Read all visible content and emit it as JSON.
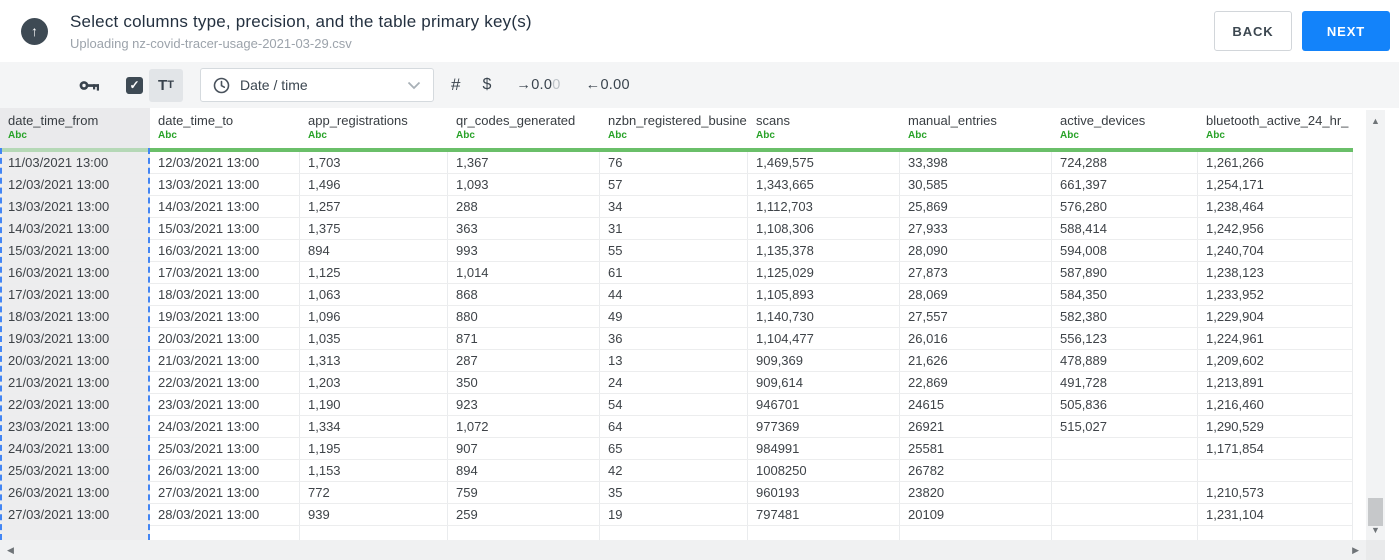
{
  "header": {
    "title": "Select columns type, precision, and the table primary key(s)",
    "subtitle": "Uploading nz-covid-tracer-usage-2021-03-29.csv",
    "back_label": "BACK",
    "next_label": "NEXT"
  },
  "toolbar": {
    "checkbox_checked": true,
    "tt_large": "T",
    "tt_small": "T",
    "type_dropdown_value": "Date / time",
    "hash_label": "#",
    "dollar_label": "$",
    "dec_right": {
      "arrow": "→",
      "main": "0.0",
      "faded": "0"
    },
    "dec_left": {
      "arrow": "←",
      "main": "0.00"
    }
  },
  "icons": {
    "upload_glyph": "↑",
    "checkmark": "✓",
    "scroll_up": "▲",
    "scroll_down": "▼",
    "scroll_left": "◀",
    "scroll_right": "▶"
  },
  "table": {
    "type_badge": "Abc",
    "columns": [
      {
        "name": "date_time_from",
        "selected": true
      },
      {
        "name": "date_time_to",
        "selected": false
      },
      {
        "name": "app_registrations",
        "selected": false
      },
      {
        "name": "qr_codes_generated",
        "selected": false
      },
      {
        "name": "nzbn_registered_busine",
        "selected": false
      },
      {
        "name": "scans",
        "selected": false
      },
      {
        "name": "manual_entries",
        "selected": false
      },
      {
        "name": "active_devices",
        "selected": false
      },
      {
        "name": "bluetooth_active_24_hr_",
        "selected": false
      }
    ],
    "rows": [
      [
        "11/03/2021 13:00",
        "12/03/2021 13:00",
        "1,703",
        "1,367",
        "76",
        "1,469,575",
        "33,398",
        "724,288",
        "1,261,266"
      ],
      [
        "12/03/2021 13:00",
        "13/03/2021 13:00",
        "1,496",
        "1,093",
        "57",
        "1,343,665",
        "30,585",
        "661,397",
        "1,254,171"
      ],
      [
        "13/03/2021 13:00",
        "14/03/2021 13:00",
        "1,257",
        "288",
        "34",
        "1,112,703",
        "25,869",
        "576,280",
        "1,238,464"
      ],
      [
        "14/03/2021 13:00",
        "15/03/2021 13:00",
        "1,375",
        "363",
        "31",
        "1,108,306",
        "27,933",
        "588,414",
        "1,242,956"
      ],
      [
        "15/03/2021 13:00",
        "16/03/2021 13:00",
        "894",
        "993",
        "55",
        "1,135,378",
        "28,090",
        "594,008",
        "1,240,704"
      ],
      [
        "16/03/2021 13:00",
        "17/03/2021 13:00",
        "1,125",
        "1,014",
        "61",
        "1,125,029",
        "27,873",
        "587,890",
        "1,238,123"
      ],
      [
        "17/03/2021 13:00",
        "18/03/2021 13:00",
        "1,063",
        "868",
        "44",
        "1,105,893",
        "28,069",
        "584,350",
        "1,233,952"
      ],
      [
        "18/03/2021 13:00",
        "19/03/2021 13:00",
        "1,096",
        "880",
        "49",
        "1,140,730",
        "27,557",
        "582,380",
        "1,229,904"
      ],
      [
        "19/03/2021 13:00",
        "20/03/2021 13:00",
        "1,035",
        "871",
        "36",
        "1,104,477",
        "26,016",
        "556,123",
        "1,224,961"
      ],
      [
        "20/03/2021 13:00",
        "21/03/2021 13:00",
        "1,313",
        "287",
        "13",
        "909,369",
        "21,626",
        "478,889",
        "1,209,602"
      ],
      [
        "21/03/2021 13:00",
        "22/03/2021 13:00",
        "1,203",
        "350",
        "24",
        "909,614",
        "22,869",
        "491,728",
        "1,213,891"
      ],
      [
        "22/03/2021 13:00",
        "23/03/2021 13:00",
        "1,190",
        "923",
        "54",
        "946701",
        "24615",
        "505,836",
        "1,216,460"
      ],
      [
        "23/03/2021 13:00",
        "24/03/2021 13:00",
        "1,334",
        "1,072",
        "64",
        "977369",
        "26921",
        "515,027",
        "1,290,529"
      ],
      [
        "24/03/2021 13:00",
        "25/03/2021 13:00",
        "1,195",
        "907",
        "65",
        "984991",
        "25581",
        "",
        "1,171,854"
      ],
      [
        "25/03/2021 13:00",
        "26/03/2021 13:00",
        "1,153",
        "894",
        "42",
        "1008250",
        "26782",
        "",
        ""
      ],
      [
        "26/03/2021 13:00",
        "27/03/2021 13:00",
        "772",
        "759",
        "35",
        "960193",
        "23820",
        "",
        "1,210,573"
      ],
      [
        "27/03/2021 13:00",
        "28/03/2021 13:00",
        "939",
        "259",
        "19",
        "797481",
        "20109",
        "",
        "1,231,104"
      ]
    ]
  },
  "colors": {
    "accent_blue": "#1383fa",
    "type_green": "#28a228",
    "header_underline_green": "#6abf69",
    "selection_dash_blue": "#4285f4"
  }
}
